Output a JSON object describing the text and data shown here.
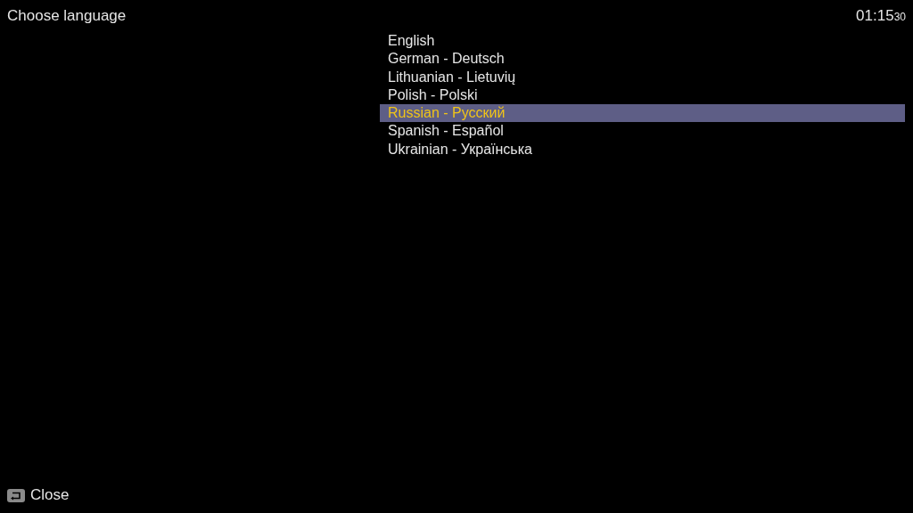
{
  "header": {
    "title": "Choose language",
    "clock": {
      "time": "01:15",
      "seconds": "30"
    }
  },
  "languages": [
    {
      "label": "English",
      "selected": false
    },
    {
      "label": "German - Deutsch",
      "selected": false
    },
    {
      "label": "Lithuanian - Lietuvių",
      "selected": false
    },
    {
      "label": "Polish - Polski",
      "selected": false
    },
    {
      "label": "Russian - Русский",
      "selected": true
    },
    {
      "label": "Spanish - Español",
      "selected": false
    },
    {
      "label": "Ukrainian - Українська",
      "selected": false
    }
  ],
  "footer": {
    "close_label": "Close"
  }
}
